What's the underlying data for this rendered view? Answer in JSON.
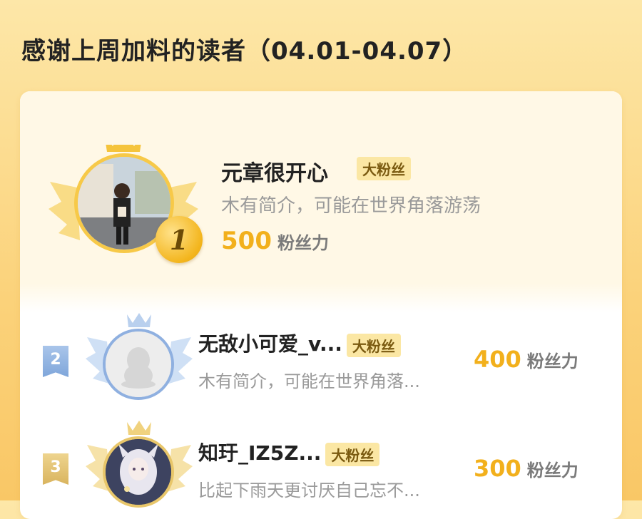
{
  "page": {
    "title": "感谢上周加料的读者（04.01-04.07）"
  },
  "leaderboard": {
    "score_unit": "粉丝力",
    "badge_label": "大粉丝",
    "entries": [
      {
        "rank": "1",
        "name": "元章很开心",
        "badge": "大粉丝",
        "bio": "木有简介，可能在世界角落游荡",
        "score": "500",
        "avatar": "photo-avatar"
      },
      {
        "rank": "2",
        "name": "无敌小可爱_v...",
        "badge": "大粉丝",
        "bio": "木有简介，可能在世界角落...",
        "score": "400",
        "avatar": "default-penguin-avatar"
      },
      {
        "rank": "3",
        "name": "知玗_IZ5Z...",
        "badge": "大粉丝",
        "bio": "比起下雨天更讨厌自己忘不...",
        "score": "300",
        "avatar": "anime-avatar"
      }
    ]
  },
  "colors": {
    "background_top": "#fde7a8",
    "background_bottom": "#f9c766",
    "accent_gold": "#f2b01c",
    "badge_bg": "#fbe7a4",
    "silver_blue": "#7fa6da"
  }
}
